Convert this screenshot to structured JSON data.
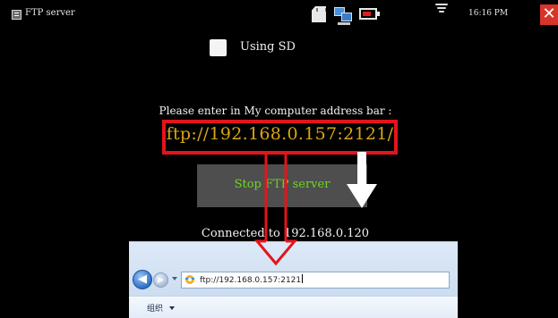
{
  "statusbar": {
    "app_title": "FTP server",
    "time": "16:16 PM",
    "icons": [
      "app-icon",
      "sd-card-icon",
      "network-icon",
      "battery-icon",
      "wifi-icon",
      "close-icon"
    ],
    "close_color": "#d8352a"
  },
  "main": {
    "sd_checkbox": {
      "label": "Using SD",
      "checked": false
    },
    "instruction": "Please enter in My computer address bar :",
    "ftp_address": "ftp://192.168.0.157:2121/",
    "stop_button_label": "Stop FTP server",
    "connected_text": "Connected to 192.168.0.120"
  },
  "browser": {
    "url": "ftp://192.168.0.157:2121",
    "menu_label": "组织",
    "icons": [
      "back-arrow-icon",
      "forward-arrow-icon",
      "ie-icon"
    ]
  },
  "colors": {
    "background": "#000000",
    "ftp_address": "#d9a514",
    "stop_label": "#6dd51e",
    "highlight": "#e4141b"
  }
}
